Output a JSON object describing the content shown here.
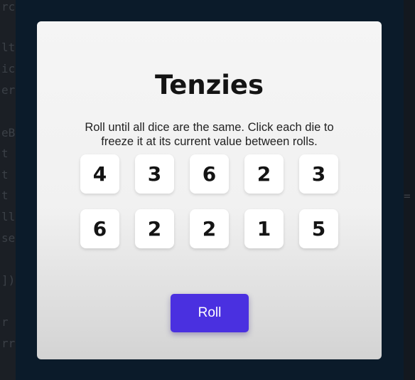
{
  "background_code": {
    "left_fragments": [
      "rc",
      "lt",
      "ic",
      "er",
      "eB",
      "t",
      "t",
      "t",
      "ll",
      "se",
      "])",
      "r",
      "rr"
    ],
    "right_fragment": "="
  },
  "game": {
    "title": "Tenzies",
    "instructions_line1": "Roll until all dice are the same. Click each die to",
    "instructions_line2": "freeze it at its current value between rolls.",
    "dice": [
      4,
      3,
      6,
      2,
      3,
      6,
      2,
      2,
      1,
      5
    ],
    "roll_label": "Roll"
  },
  "colors": {
    "page_background": "#0b1b2a",
    "card_background": "#f5f5f5",
    "die_background": "#ffffff",
    "button_background": "#4a30e0",
    "button_text": "#ffffff"
  }
}
